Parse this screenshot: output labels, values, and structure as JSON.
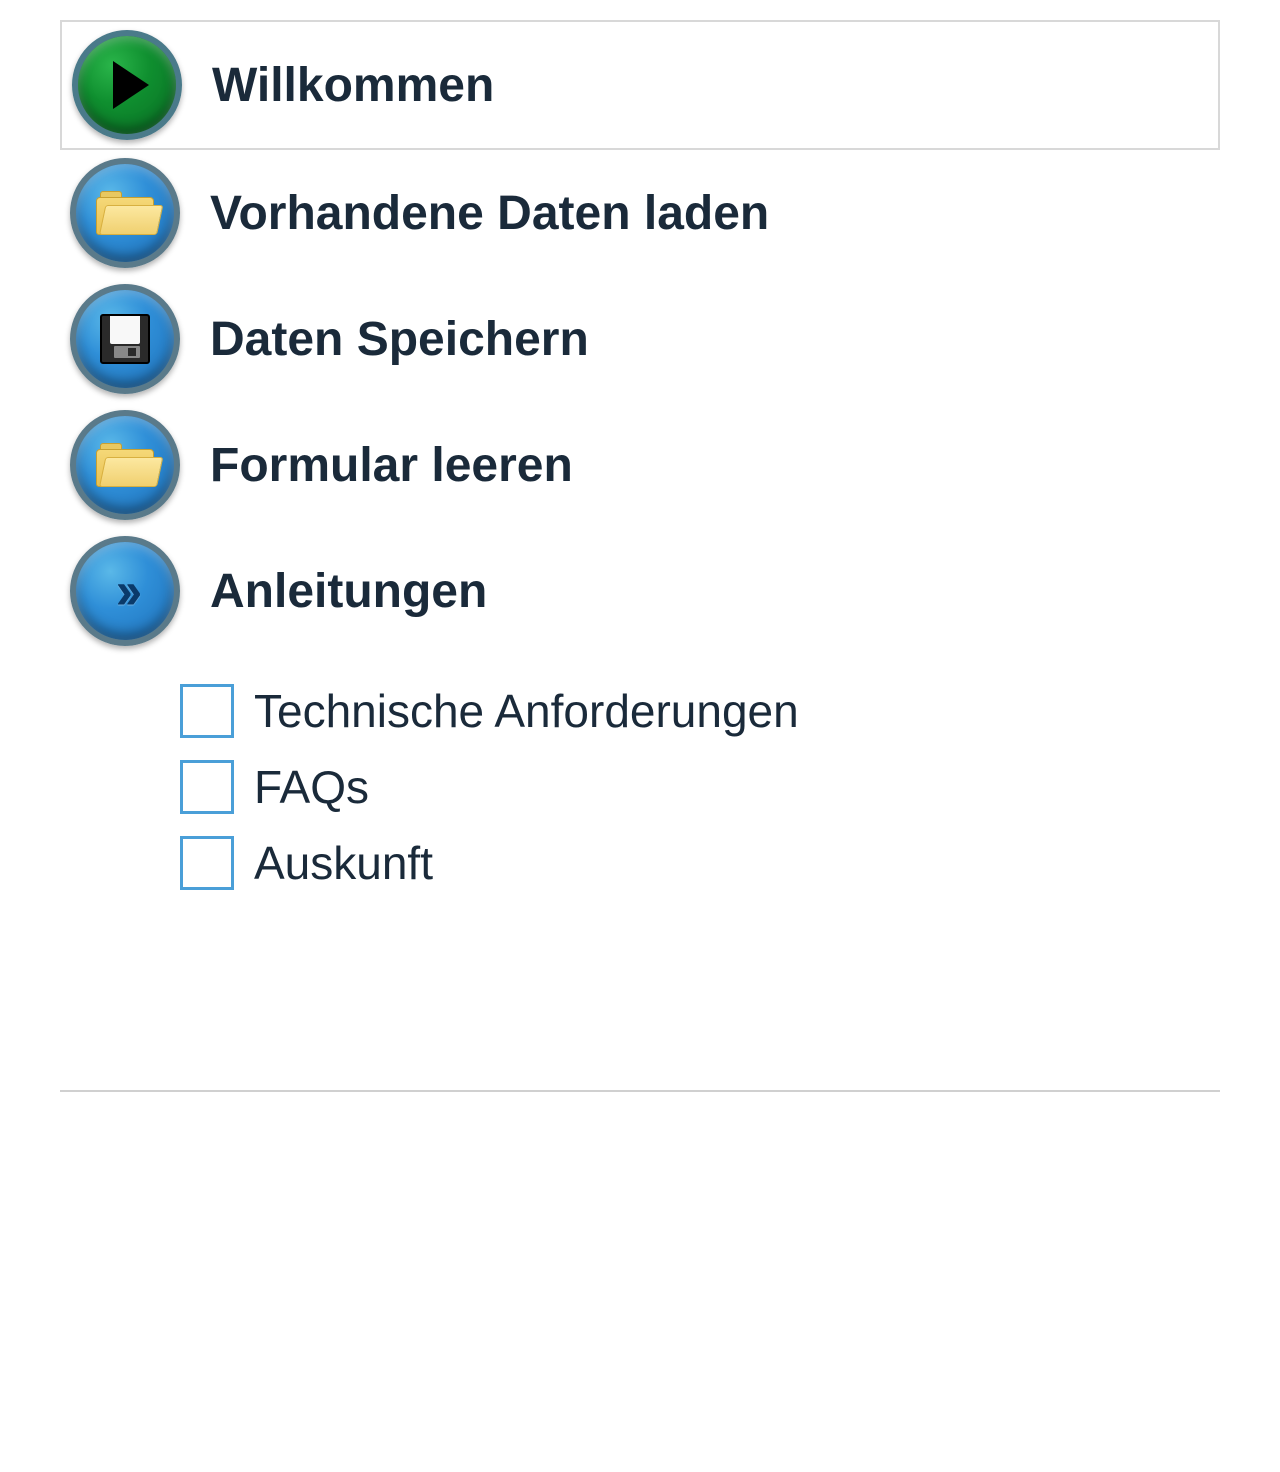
{
  "menu": {
    "items": [
      {
        "label": "Willkommen",
        "icon": "play",
        "color": "green",
        "selected": true
      },
      {
        "label": "Vorhandene Daten laden",
        "icon": "folder",
        "color": "blue",
        "selected": false
      },
      {
        "label": "Daten Speichern",
        "icon": "save",
        "color": "blue",
        "selected": false
      },
      {
        "label": "Formular leeren",
        "icon": "folder",
        "color": "blue",
        "selected": false
      },
      {
        "label": "Anleitungen",
        "icon": "chevrons",
        "color": "blue",
        "selected": false
      }
    ]
  },
  "sub_menu": {
    "items": [
      {
        "label": "Technische Anforderungen",
        "checked": false
      },
      {
        "label": "FAQs",
        "checked": false
      },
      {
        "label": "Auskunft",
        "checked": false
      }
    ]
  }
}
